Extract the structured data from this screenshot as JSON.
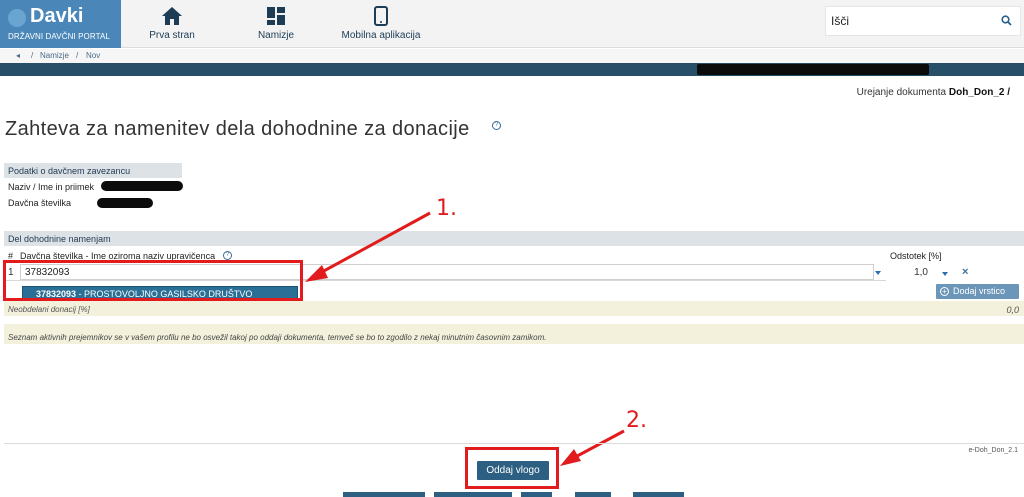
{
  "header": {
    "logo_title": "Davki",
    "logo_subtitle": "DRŽAVNI DAVČNI PORTAL",
    "nav": [
      {
        "label": "Prva stran",
        "icon": "home-icon"
      },
      {
        "label": "Namizje",
        "icon": "dashboard-icon"
      },
      {
        "label": "Mobilna aplikacija",
        "icon": "mobile-icon"
      }
    ],
    "search": {
      "value": "Išči",
      "icon": "search-icon"
    }
  },
  "breadcrumb": {
    "items": [
      "Namizje",
      "Nov"
    ]
  },
  "document_label": {
    "prefix": "Urejanje dokumenta",
    "name": "Doh_Don_2 /"
  },
  "page_title": "Zahteva za namenitev dela dohodnine za donacije",
  "taxpayer_panel": {
    "heading": "Podatki o davčnem zavezancu",
    "name_label": "Naziv / Ime in priimek",
    "tax_label": "Davčna številka"
  },
  "donation_panel": {
    "heading": "Del dohodnine namenjam",
    "col_hash": "#",
    "col_recipient": "Davčna številka - Ime oziroma naziv upravičenca",
    "col_percent": "Odstotek [%]",
    "row_number": "1",
    "tax_input_value": "37832093",
    "percent_value": "1,0",
    "dropdown_option_code": "37832093",
    "dropdown_option_name": " - PROSTOVOLJNO GASILSKO DRUŠTVO KRŠKO",
    "add_row_label": "Dodaj vrstico",
    "total_label": "Neobdelani donacij [%]",
    "total_value": "0,0",
    "notice": "Seznam aktivnih prejemnikov se v vašem profilu ne bo osvežil takoj po oddaji dokumenta, temveč se bo to zgodilo z nekaj minutnim časovnim zamikom."
  },
  "annotations": {
    "one": "1.",
    "two": "2."
  },
  "footer": {
    "version": "e-Doh_Don_2.1",
    "submit_label": "Oddaj vlogo"
  },
  "colors": {
    "header_blue": "#4a87b8",
    "dark_bar": "#284f68",
    "annotation_red": "#e21c1c",
    "button_blue": "#2c5f82"
  }
}
